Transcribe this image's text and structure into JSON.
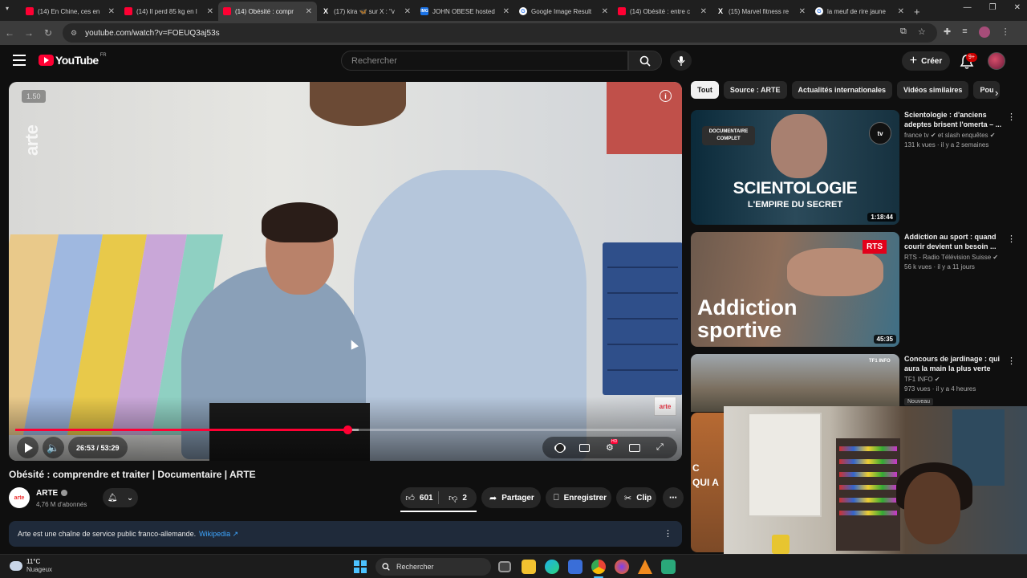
{
  "browser": {
    "tabs": [
      {
        "title": "(14) En Chine, ces en",
        "icon": "youtube-icon",
        "active": false
      },
      {
        "title": "(14) Il perd 85 kg en l",
        "icon": "youtube-icon",
        "active": false
      },
      {
        "title": "(14) Obésité : compr",
        "icon": "youtube-icon",
        "active": true
      },
      {
        "title": "(17) kira 🦋 sur X : \"v",
        "icon": "x-icon",
        "active": false
      },
      {
        "title": "JOHN OBESE hosted",
        "icon": "image-icon",
        "active": false
      },
      {
        "title": "Google Image Result",
        "icon": "google-icon",
        "active": false
      },
      {
        "title": "(14) Obésité : entre c",
        "icon": "youtube-icon",
        "active": false
      },
      {
        "title": "(15) Marvel fitness re",
        "icon": "x-icon",
        "active": false
      },
      {
        "title": "la meuf de rire jaune",
        "icon": "google-icon",
        "active": false
      }
    ],
    "url": "youtube.com/watch?v=FOEUQ3aj53s"
  },
  "youtube": {
    "logo_text": "YouTube",
    "country": "FR",
    "search_placeholder": "Rechercher",
    "create_label": "Créer",
    "notif_count": "9+"
  },
  "player": {
    "speed": "1.50",
    "watermark": "arte",
    "corner_logo": "arte",
    "time": "26:53 / 53:29",
    "progress": 0.503,
    "buffered": 0.52
  },
  "video": {
    "title": "Obésité : comprendre et traiter | Documentaire | ARTE",
    "channel": "ARTE",
    "channel_avatar": "arte",
    "subscribers": "4,76 M d'abonnés",
    "likes": "601",
    "dislikes": "2",
    "share_label": "Partager",
    "save_label": "Enregistrer",
    "clip_label": "Clip",
    "description": "Arte est une chaîne de service public franco-allemande.",
    "description_link": "Wikipedia ↗"
  },
  "sidebar": {
    "chips": [
      "Tout",
      "Source : ARTE",
      "Actualités internationales",
      "Vidéos similaires",
      "Pou"
    ],
    "recommendations": [
      {
        "title": "Scientologie : d'anciens adeptes brisent l'omerta – ...",
        "channel": "france tv ✔ et slash enquêtes ✔",
        "views": "131 k vues · il y a 2 semaines",
        "duration": "1:18:44",
        "thumb_badge": "DOCUMENTAIRE COMPLET",
        "thumb_text": "SCIENTOLOGIE",
        "thumb_subtext": "L'EMPIRE DU SECRET",
        "thumb_logo": "tv",
        "badge": ""
      },
      {
        "title": "Addiction au sport : quand courir devient un besoin ...",
        "channel": "RTS - Radio Télévision Suisse ✔",
        "views": "56 k vues · il y a 11 jours",
        "duration": "45:35",
        "thumb_text": "Addiction sportive",
        "thumb_logo": "RTS",
        "badge": ""
      },
      {
        "title": "Concours de jardinage : qui aura la main la plus verte ?...",
        "channel": "TF1 INFO ✔",
        "views": "973 vues · il y a 4 heures",
        "duration": "",
        "thumb_logo": "TF1 INFO",
        "badge": "Nouveau"
      }
    ],
    "partial_card_text": "C\nQUI A"
  },
  "taskbar": {
    "temperature": "11°C",
    "weather": "Nuageux",
    "search_label": "Rechercher"
  }
}
